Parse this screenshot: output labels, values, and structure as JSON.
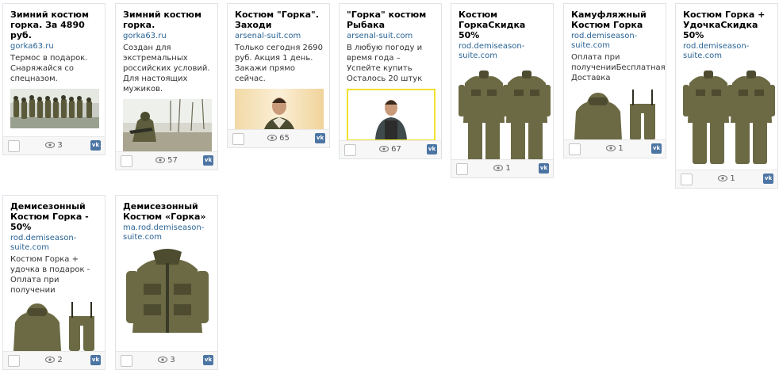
{
  "cards": [
    {
      "title": "Зимний костюм горка. За 4890 руб.",
      "domain": "gorka63.ru",
      "description": "Термос в подарок. Снаряжайся со спецназом.",
      "views": "3",
      "image": "soldiers-group-photo"
    },
    {
      "title": "Зимний костюм горка.",
      "domain": "gorka63.ru",
      "description": "Создан для экстремальных российских условий. Для настоящих мужиков.",
      "views": "57",
      "image": "soldier-outdoor-photo"
    },
    {
      "title": "Костюм \"Горка\". Заходи",
      "domain": "arsenal-suit.com",
      "description": "Только сегодня 2690 руб. Акция 1 день. Закажи прямо сейчас.",
      "views": "65",
      "image": "man-in-jacket-photo"
    },
    {
      "title": "\"Горка\" костюм Рыбака",
      "domain": "arsenal-suit.com",
      "description": "В любую погоду и время года – Успейте купить Осталось 20 штук",
      "views": "67",
      "image": "man-in-suit-yellow-frame-photo"
    },
    {
      "title": "Костюм ГоркаСкидка 50%",
      "domain": "rod.demiseason-suite.com",
      "description": "",
      "views": "1",
      "image": "two-suits-photo"
    },
    {
      "title": "Камуфляжный Костюм Горка",
      "domain": "rod.demiseason-suite.com",
      "description": "Оплата при полученииБесплатная Доставка",
      "views": "1",
      "image": "jacket-and-overalls-photo"
    },
    {
      "title": "Костюм Горка + УдочкаСкидка 50%",
      "domain": "rod.demiseason-suite.com",
      "description": "",
      "views": "1",
      "image": "two-suits-photo"
    },
    {
      "title": "Демисезонный Костюм Горка - 50%",
      "domain": "rod.demiseason-suite.com",
      "description": "Костюм Горка + удочка в подарок - Оплата при получении",
      "views": "2",
      "image": "jacket-and-overalls-photo"
    },
    {
      "title": "Демисезонный Костюм «Горка»",
      "domain": "ma.rod.demiseason-suite.com",
      "description": "",
      "views": "3",
      "image": "single-jacket-photo"
    }
  ],
  "vk_label": "vk",
  "colors": {
    "domain": "#2a6496",
    "vk": "#4c75a3",
    "border": "#dfe3e8",
    "suit_olive": "#6b6a44",
    "suit_dark": "#4d4c30"
  }
}
